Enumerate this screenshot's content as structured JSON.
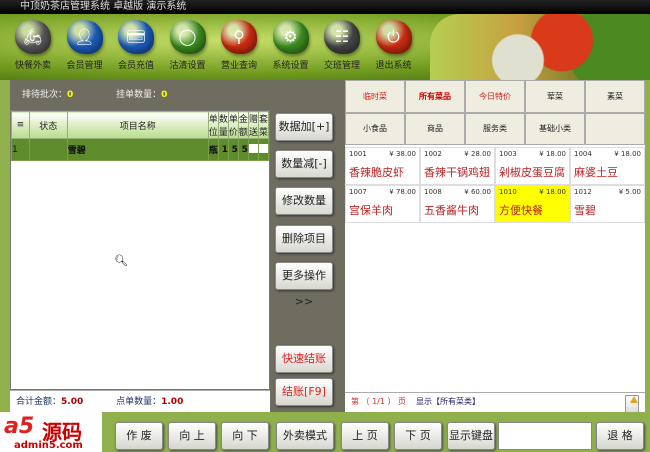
{
  "title": "中顶奶茶店管理系统 卓越版 演示系统",
  "toolbar": [
    {
      "label": "快餐外卖",
      "icon": "scooter-icon",
      "color": "#555"
    },
    {
      "label": "会员管理",
      "icon": "member-icon",
      "color": "#1a5ab8"
    },
    {
      "label": "会员充值",
      "icon": "recharge-icon",
      "color": "#1a5ab8"
    },
    {
      "label": "沽清设置",
      "icon": "plate-icon",
      "color": "#3a8a20"
    },
    {
      "label": "营业查询",
      "icon": "search-icon",
      "color": "#c82a10"
    },
    {
      "label": "系统设置",
      "icon": "gear-icon",
      "color": "#3a8a20"
    },
    {
      "label": "交班管理",
      "icon": "shift-icon",
      "color": "#444"
    },
    {
      "label": "退出系统",
      "icon": "power-icon",
      "color": "#c82a10"
    }
  ],
  "stats": {
    "waiting_label": "排待批次：",
    "waiting": "0",
    "hold_label": "挂单数量：",
    "hold": "0"
  },
  "table": {
    "headers": [
      "≡",
      "状态",
      "项目名称",
      "单位",
      "数量",
      "单价",
      "金额",
      "赠送",
      "套菜"
    ],
    "rows": [
      {
        "no": "1",
        "status": "",
        "name": "雪碧",
        "unit": "瓶",
        "qty": "1",
        "price": "5",
        "amount": "5"
      }
    ]
  },
  "totals": {
    "amount_label": "合计金额：",
    "amount": "5.00",
    "count_label": "点单数量：",
    "count": "1.00"
  },
  "mid_buttons": [
    "数据加[+]",
    "数量减[-]",
    "修改数量",
    "删除项目",
    "更多操作>>",
    "快速结账",
    "结账[F9]"
  ],
  "categories": [
    "临时菜",
    "所有菜品",
    "今日特价",
    "荤菜",
    "素菜",
    "小食品",
    "商品",
    "服务类",
    "基础小类",
    ""
  ],
  "products": [
    {
      "code": "1001",
      "price": "¥ 38.00",
      "name": "香辣脆皮虾"
    },
    {
      "code": "1002",
      "price": "¥ 28.00",
      "name": "香辣干锅鸡翅"
    },
    {
      "code": "1003",
      "price": "¥ 18.00",
      "name": "剁椒皮蛋豆腐"
    },
    {
      "code": "1004",
      "price": "¥ 18.00",
      "name": "麻婆土豆"
    },
    {
      "code": "1007",
      "price": "¥ 78.00",
      "name": "宫保羊肉"
    },
    {
      "code": "1008",
      "price": "¥ 60.00",
      "name": "五香酱牛肉"
    },
    {
      "code": "1010",
      "price": "¥ 18.00",
      "name": "方便快餐",
      "selected": true
    },
    {
      "code": "1012",
      "price": "¥ 5.00",
      "name": "雪碧"
    }
  ],
  "pager": {
    "text": "第 （ 1/1 ） 页",
    "category": "显示【所有菜类】"
  },
  "bottom_buttons": [
    "作 废",
    "向 上",
    "向 下",
    "外卖模式",
    "上 页",
    "下 页",
    "显示键盘",
    "退 格"
  ],
  "logo": {
    "brand": "a5",
    "text": "源码",
    "domain": "admin5.com"
  }
}
